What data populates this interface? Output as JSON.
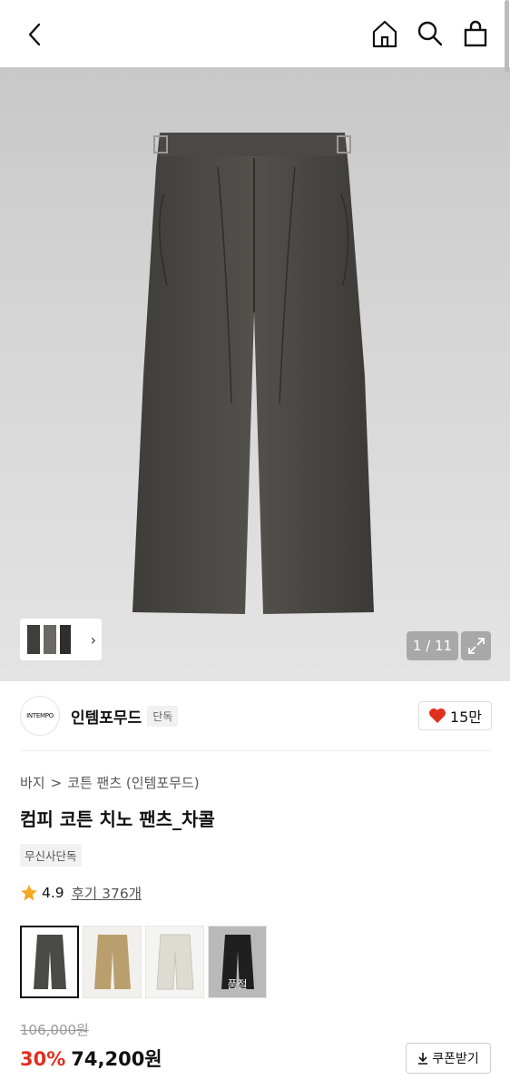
{
  "topbar": {
    "back_icon": "chevron-left-icon",
    "home_icon": "home-icon",
    "search_icon": "search-icon",
    "cart_icon": "shopping-bag-icon"
  },
  "gallery": {
    "counter": "1 / 11",
    "expand_icon": "expand-icon",
    "thumb_chevron": "›"
  },
  "brand": {
    "logo_text": "INTEMPO",
    "name": "인템포무드",
    "badge": "단독",
    "likes": "15만"
  },
  "product": {
    "breadcrumb": [
      "바지",
      "코튼 팬츠 (인템포무드)"
    ],
    "breadcrumb_sep": ">",
    "title": "컴피 코튼 치노 팬츠_차콜",
    "tag": "무신사단독",
    "rating": "4.9",
    "reviews": "후기 376개",
    "swatches": [
      {
        "color": "#4a4a46",
        "label": ""
      },
      {
        "color": "#b99f6e",
        "label": ""
      },
      {
        "color": "#dedbd2",
        "label": ""
      },
      {
        "color": "#1f1f1f",
        "label": "품절"
      }
    ],
    "original_price": "106,000원",
    "discount": "30%",
    "price": "74,200원",
    "coupon_label": "쿠폰받기"
  },
  "colors": {
    "accent": "#e0301e",
    "heart": "#e0301e",
    "star": "#f5a623"
  }
}
